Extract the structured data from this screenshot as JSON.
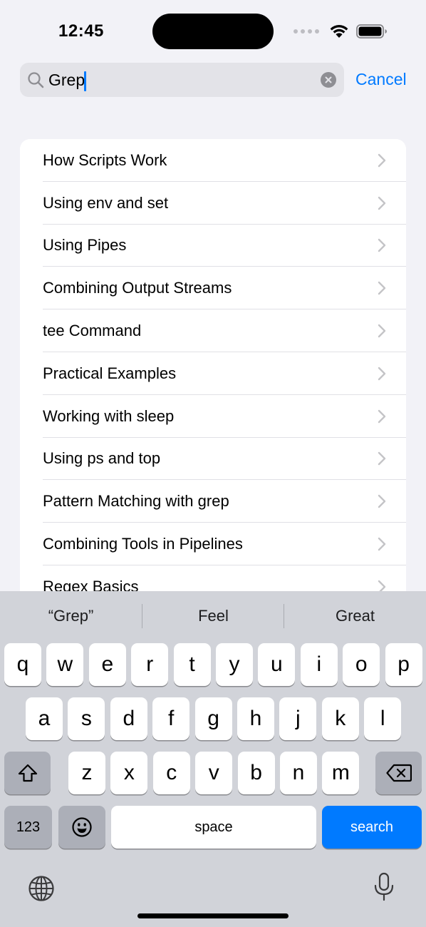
{
  "status": {
    "time": "12:45"
  },
  "search": {
    "value": "Grep",
    "cancel_label": "Cancel"
  },
  "list": {
    "items": [
      "How Scripts Work",
      "Using env and set",
      "Using Pipes",
      "Combining Output Streams",
      "tee Command",
      "Practical Examples",
      "Working with sleep",
      "Using ps and top",
      "Pattern Matching with grep",
      "Combining Tools in Pipelines",
      "Regex Basics"
    ]
  },
  "keyboard": {
    "suggestions": [
      "“Grep”",
      "Feel",
      "Great"
    ],
    "row1": [
      "q",
      "w",
      "e",
      "r",
      "t",
      "y",
      "u",
      "i",
      "o",
      "p"
    ],
    "row2": [
      "a",
      "s",
      "d",
      "f",
      "g",
      "h",
      "j",
      "k",
      "l"
    ],
    "row3": [
      "z",
      "x",
      "c",
      "v",
      "b",
      "n",
      "m"
    ],
    "numbers_label": "123",
    "space_label": "space",
    "search_label": "search",
    "icons": {
      "shift": "shift-icon",
      "delete": "delete-icon",
      "emoji": "emoji-icon",
      "globe": "globe-icon",
      "mic": "microphone-icon"
    }
  },
  "colors": {
    "accent": "#007aff",
    "background": "#f2f2f7",
    "keyboard": "#d1d3d9"
  }
}
